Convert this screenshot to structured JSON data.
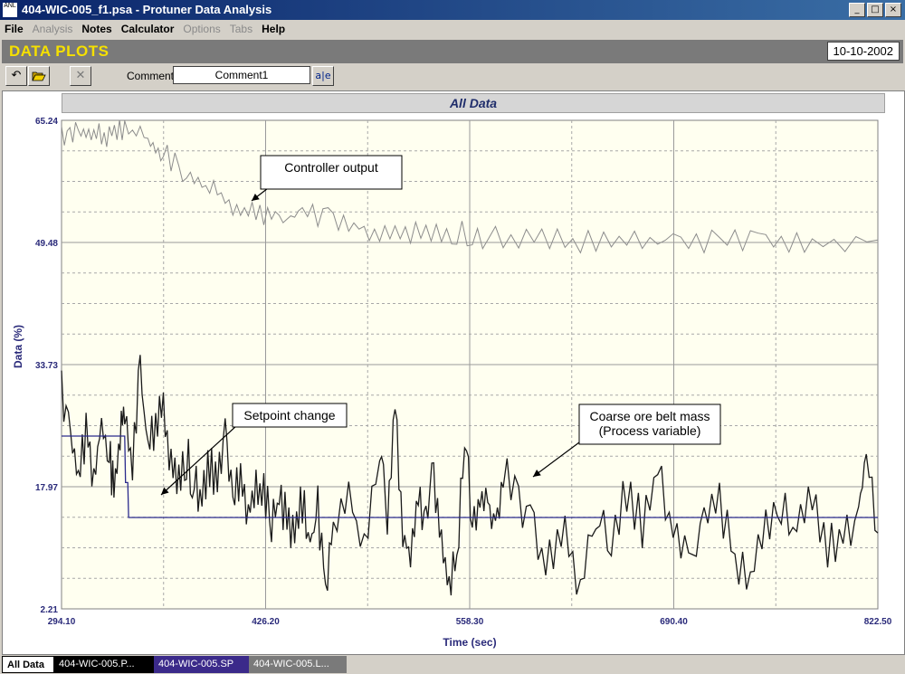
{
  "window": {
    "title": "404-WIC-005_f1.psa - Protuner Data  Analysis",
    "app_icon": "ANL",
    "minimize": "_",
    "maximize": "□",
    "close": "×"
  },
  "menu": [
    {
      "label": "File",
      "enabled": true
    },
    {
      "label": "Analysis",
      "enabled": false
    },
    {
      "label": "Notes",
      "enabled": true
    },
    {
      "label": "Calculator",
      "enabled": true
    },
    {
      "label": "Options",
      "enabled": false
    },
    {
      "label": "Tabs",
      "enabled": false
    },
    {
      "label": "Help",
      "enabled": true
    }
  ],
  "banner": {
    "heading": "DATA PLOTS",
    "date": "10-10-2002"
  },
  "toolbar": {
    "undo_icon": "undo-icon",
    "open_icon": "folder-open-icon",
    "delete_icon": "delete-x-icon",
    "comment_label": "Comment",
    "comment_value": "Comment1",
    "edit_icon": "text-edit-icon",
    "edit_glyph": "a|e"
  },
  "plot": {
    "title": "All Data"
  },
  "colors": {
    "plot_bg": "#fffff0",
    "pv": "#1a1a1a",
    "co": "#8c8c8c",
    "sp": "#2a2a8c",
    "axis_text": "#2a2a7a"
  },
  "chart_data": {
    "type": "line",
    "title": "All Data",
    "xlabel": "Time (sec)",
    "ylabel": "Data (%)",
    "xlim": [
      294.1,
      822.5
    ],
    "ylim": [
      2.21,
      65.24
    ],
    "x_ticks": [
      "294.10",
      "426.20",
      "558.30",
      "690.40",
      "822.50"
    ],
    "y_ticks": [
      "65.24",
      "49.48",
      "33.73",
      "17.97",
      "2.21"
    ],
    "grid": true,
    "series": [
      {
        "role": "controller-output",
        "x": [
          294.1,
          305,
          315,
          325,
          335,
          350,
          360,
          375,
          390,
          405,
          420,
          435,
          450,
          470,
          490,
          510,
          530,
          550,
          570,
          600,
          630,
          660,
          690,
          720,
          750,
          780,
          822.5
        ],
        "y": [
          63,
          63.5,
          64,
          63.2,
          64,
          63,
          61,
          58,
          56.5,
          54,
          53,
          52.5,
          53,
          52.5,
          51.5,
          50.2,
          50.8,
          50.8,
          50,
          49.8,
          49.7,
          49.5,
          49.2,
          49.8,
          50,
          49.6,
          49.8
        ]
      },
      {
        "role": "process-variable",
        "x": [
          294.1,
          300,
          305,
          310,
          315,
          320,
          325,
          328,
          332,
          335,
          340,
          345,
          350,
          355,
          360,
          365,
          370,
          375,
          380,
          385,
          390,
          395,
          400,
          405,
          410,
          415,
          420,
          425,
          430,
          435,
          440,
          445,
          450,
          455,
          460,
          465,
          470,
          480,
          490,
          500,
          505,
          510,
          515,
          520,
          525,
          530,
          535,
          540,
          545,
          550,
          555,
          560,
          565,
          570,
          575,
          580,
          590,
          600,
          610,
          620,
          630,
          640,
          650,
          660,
          670,
          680,
          690,
          700,
          710,
          720,
          730,
          740,
          750,
          760,
          770,
          780,
          790,
          800,
          810,
          815,
          822.5
        ],
        "y": [
          30,
          24,
          20,
          25,
          18,
          27,
          22,
          17,
          24,
          28,
          20,
          34,
          22,
          26,
          30,
          20,
          19,
          22,
          18,
          16,
          21,
          18,
          24,
          16,
          20,
          15,
          19,
          17,
          14,
          18,
          13,
          12,
          16,
          10,
          15,
          5,
          13,
          16,
          11,
          24,
          14,
          28,
          12,
          9,
          16,
          13,
          20,
          11,
          4,
          9,
          26,
          13,
          17,
          16,
          14,
          19,
          17,
          12,
          8,
          13,
          5,
          14,
          11,
          17,
          13,
          20,
          12,
          9,
          14,
          16,
          8,
          6,
          12,
          15,
          13,
          16,
          10,
          12,
          14,
          22,
          12
        ]
      },
      {
        "role": "setpoint",
        "x": [
          294.1,
          335,
          335.5,
          337,
          337.5,
          822.5
        ],
        "y": [
          24.5,
          24.5,
          18.5,
          18.5,
          14,
          14
        ]
      }
    ]
  },
  "tabs": [
    {
      "label": "All Data"
    },
    {
      "label": "404-WIC-005.P..."
    },
    {
      "label": "404-WIC-005.SP"
    },
    {
      "label": "404-WIC-005.L..."
    }
  ],
  "annotations": [
    {
      "text": "Controller output"
    },
    {
      "text": "Setpoint change"
    },
    {
      "text": "Coarse ore belt mass"
    },
    {
      "text": "(Process variable)"
    }
  ]
}
